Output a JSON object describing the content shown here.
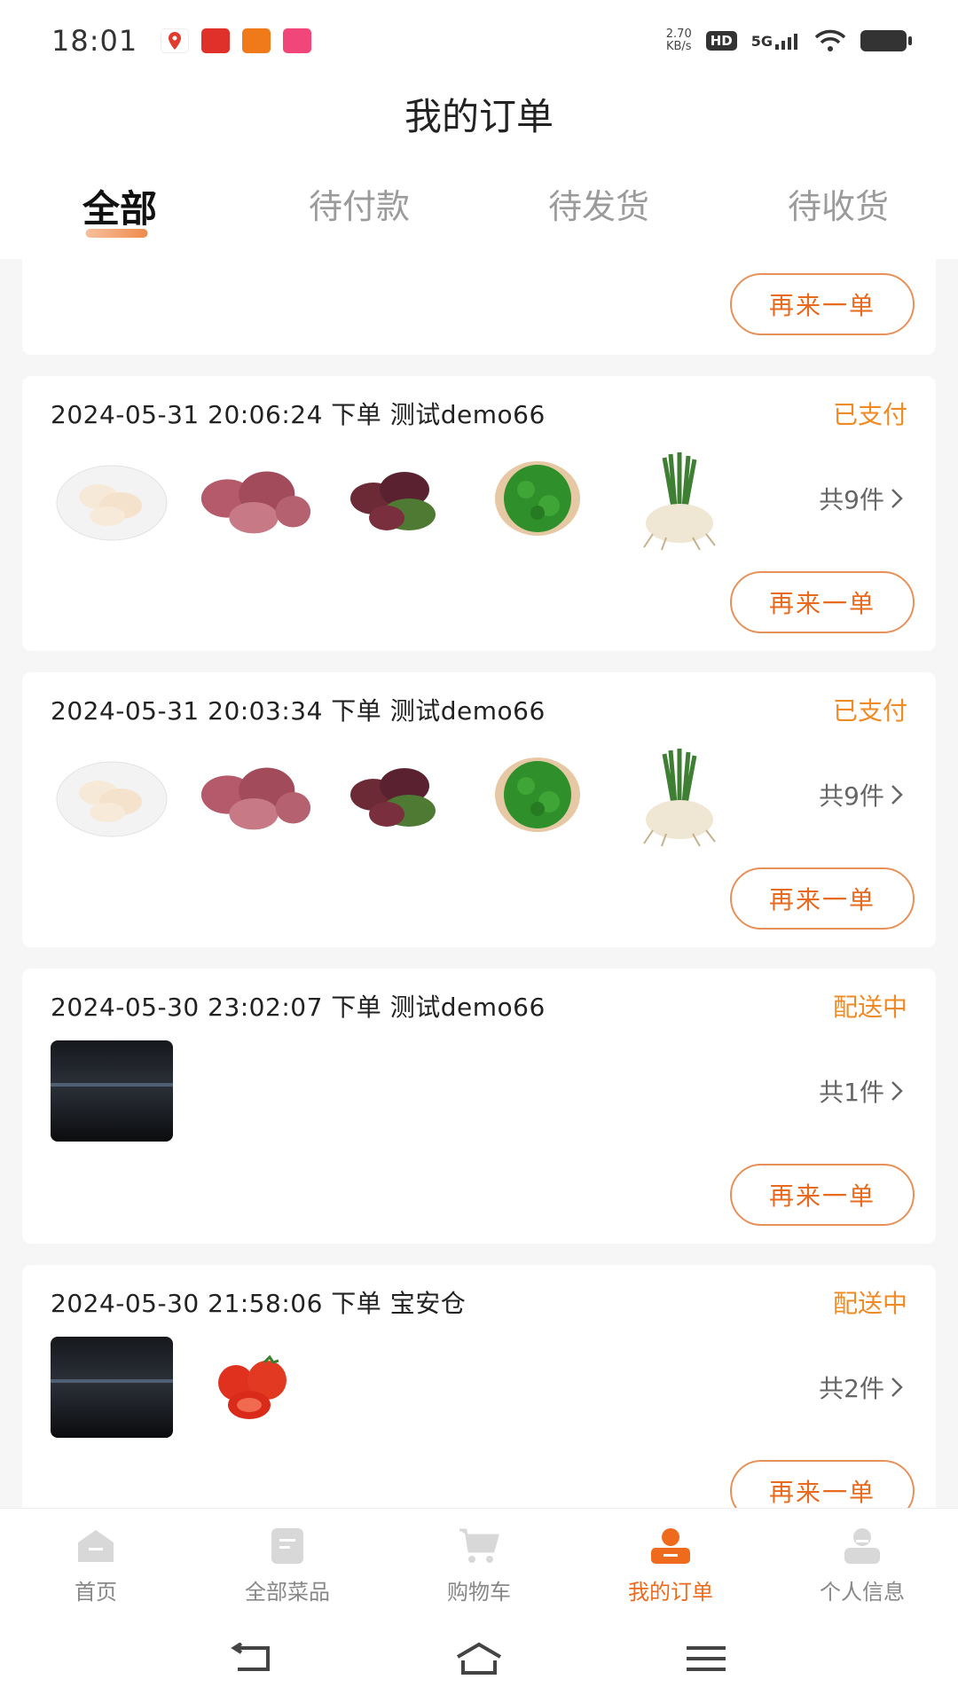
{
  "status_bar": {
    "time": "18:01",
    "net_speed_value": "2.70",
    "net_speed_unit": "KB/s",
    "hd": "HD",
    "network": "5G",
    "notification_icons": [
      "map-pin-app-icon",
      "red-app-icon",
      "orange-app-icon",
      "pink-app-icon"
    ]
  },
  "header": {
    "title": "我的订单",
    "tabs": [
      {
        "label": "全部",
        "active": true
      },
      {
        "label": "待付款",
        "active": false
      },
      {
        "label": "待发货",
        "active": false
      },
      {
        "label": "待收货",
        "active": false
      }
    ]
  },
  "orders": [
    {
      "partial": true,
      "reorder_label": "再来一单"
    },
    {
      "time": "2024-05-31 20:06:24",
      "action": "下单",
      "store": "测试demo66",
      "status": "已支付",
      "items": [
        "chicken-drumsticks",
        "pork-kidney",
        "red-amaranth",
        "parsley",
        "scallions"
      ],
      "count": "共9件",
      "reorder_label": "再来一单"
    },
    {
      "time": "2024-05-31 20:03:34",
      "action": "下单",
      "store": "测试demo66",
      "status": "已支付",
      "items": [
        "chicken-drumsticks",
        "pork-kidney",
        "red-amaranth",
        "parsley",
        "scallions"
      ],
      "count": "共9件",
      "reorder_label": "再来一单"
    },
    {
      "time": "2024-05-30 23:02:07",
      "action": "下单",
      "store": "测试demo66",
      "status": "配送中",
      "items": [
        "night-photo"
      ],
      "count": "共1件",
      "reorder_label": "再来一单"
    },
    {
      "time": "2024-05-30 21:58:06",
      "action": "下单",
      "store": "宝安仓",
      "status": "配送中",
      "items": [
        "night-photo",
        "tomatoes"
      ],
      "count": "共2件",
      "reorder_label": "再来一单"
    }
  ],
  "tabbar": [
    {
      "label": "首页",
      "icon": "home-icon",
      "active": false
    },
    {
      "label": "全部菜品",
      "icon": "menu-list-icon",
      "active": false
    },
    {
      "label": "购物车",
      "icon": "cart-icon",
      "active": false
    },
    {
      "label": "我的订单",
      "icon": "orders-icon",
      "active": true
    },
    {
      "label": "个人信息",
      "icon": "profile-icon",
      "active": false
    }
  ],
  "colors": {
    "accent": "#ee6a1c",
    "status": "#f08a24",
    "inactive": "#9b9b9b"
  }
}
